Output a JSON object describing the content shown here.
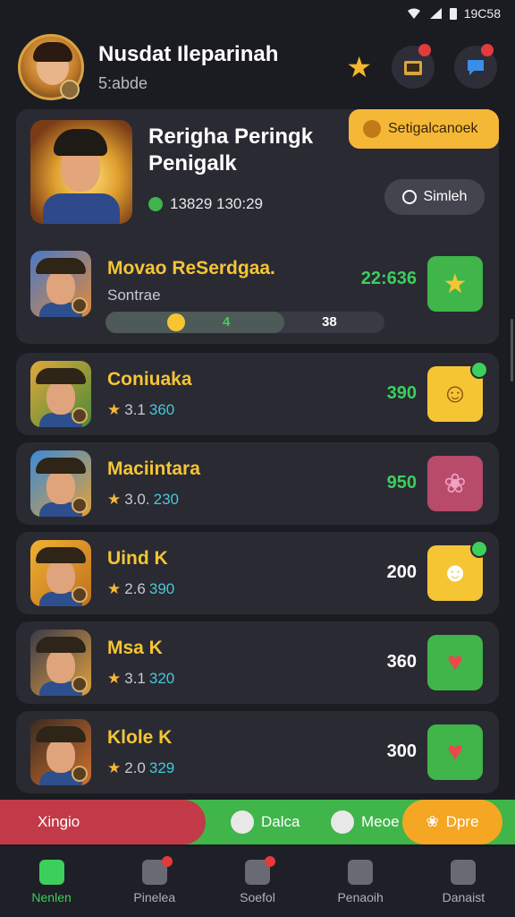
{
  "status": {
    "time": "19C58"
  },
  "header": {
    "title": "Nusdat Ileparinah",
    "subtitle": "5:abde"
  },
  "featured": {
    "tag_label": "Setigalcanoek",
    "title": "Rerigha Peringk Penigalk",
    "timer": "13829 130:29",
    "action_label": "Simleh",
    "entry": {
      "name": "Movao ReSerdgaa.",
      "subtitle": "Sontrae",
      "score": "22:636",
      "progress": {
        "marker": "4",
        "total": "38"
      }
    }
  },
  "rows": [
    {
      "name": "Coniuaka",
      "rating": "3.1",
      "points": "360",
      "score": "390",
      "score_color": "green",
      "tile": "emoji-face-icon",
      "tile_color": "#f5c534",
      "badge": true
    },
    {
      "name": "Maciintara",
      "rating": "3.0.",
      "points": "230",
      "score": "950",
      "score_color": "green",
      "tile": "tulip-icon",
      "tile_color": "#b84a6a",
      "badge": false
    },
    {
      "name": "Uind K",
      "rating": "2.6",
      "points": "390",
      "score": "200",
      "score_color": "white",
      "tile": "rice-ball-icon",
      "tile_color": "#f5c534",
      "badge": true
    },
    {
      "name": "Msa K",
      "rating": "3.1",
      "points": "320",
      "score": "360",
      "score_color": "white",
      "tile": "heart-icon",
      "tile_color": "#3fb54a",
      "badge": false
    },
    {
      "name": "Klole K",
      "rating": "2.0",
      "points": "329",
      "score": "300",
      "score_color": "white",
      "tile": "heart-icon",
      "tile_color": "#3fb54a",
      "badge": false
    }
  ],
  "actionbar": {
    "left": "Xingio",
    "mid1": "Dalca",
    "mid2": "Meoe",
    "right": "Dpre"
  },
  "nav": [
    {
      "label": "Nenlen",
      "active": true
    },
    {
      "label": "Pinelea",
      "active": false
    },
    {
      "label": "Soefol",
      "active": false
    },
    {
      "label": "Penaoih",
      "active": false
    },
    {
      "label": "Danaist",
      "active": false
    }
  ],
  "colors": {
    "accent_green": "#3ccf5c",
    "gold": "#f5c534",
    "orange": "#f5a623",
    "red": "#c23a48"
  }
}
